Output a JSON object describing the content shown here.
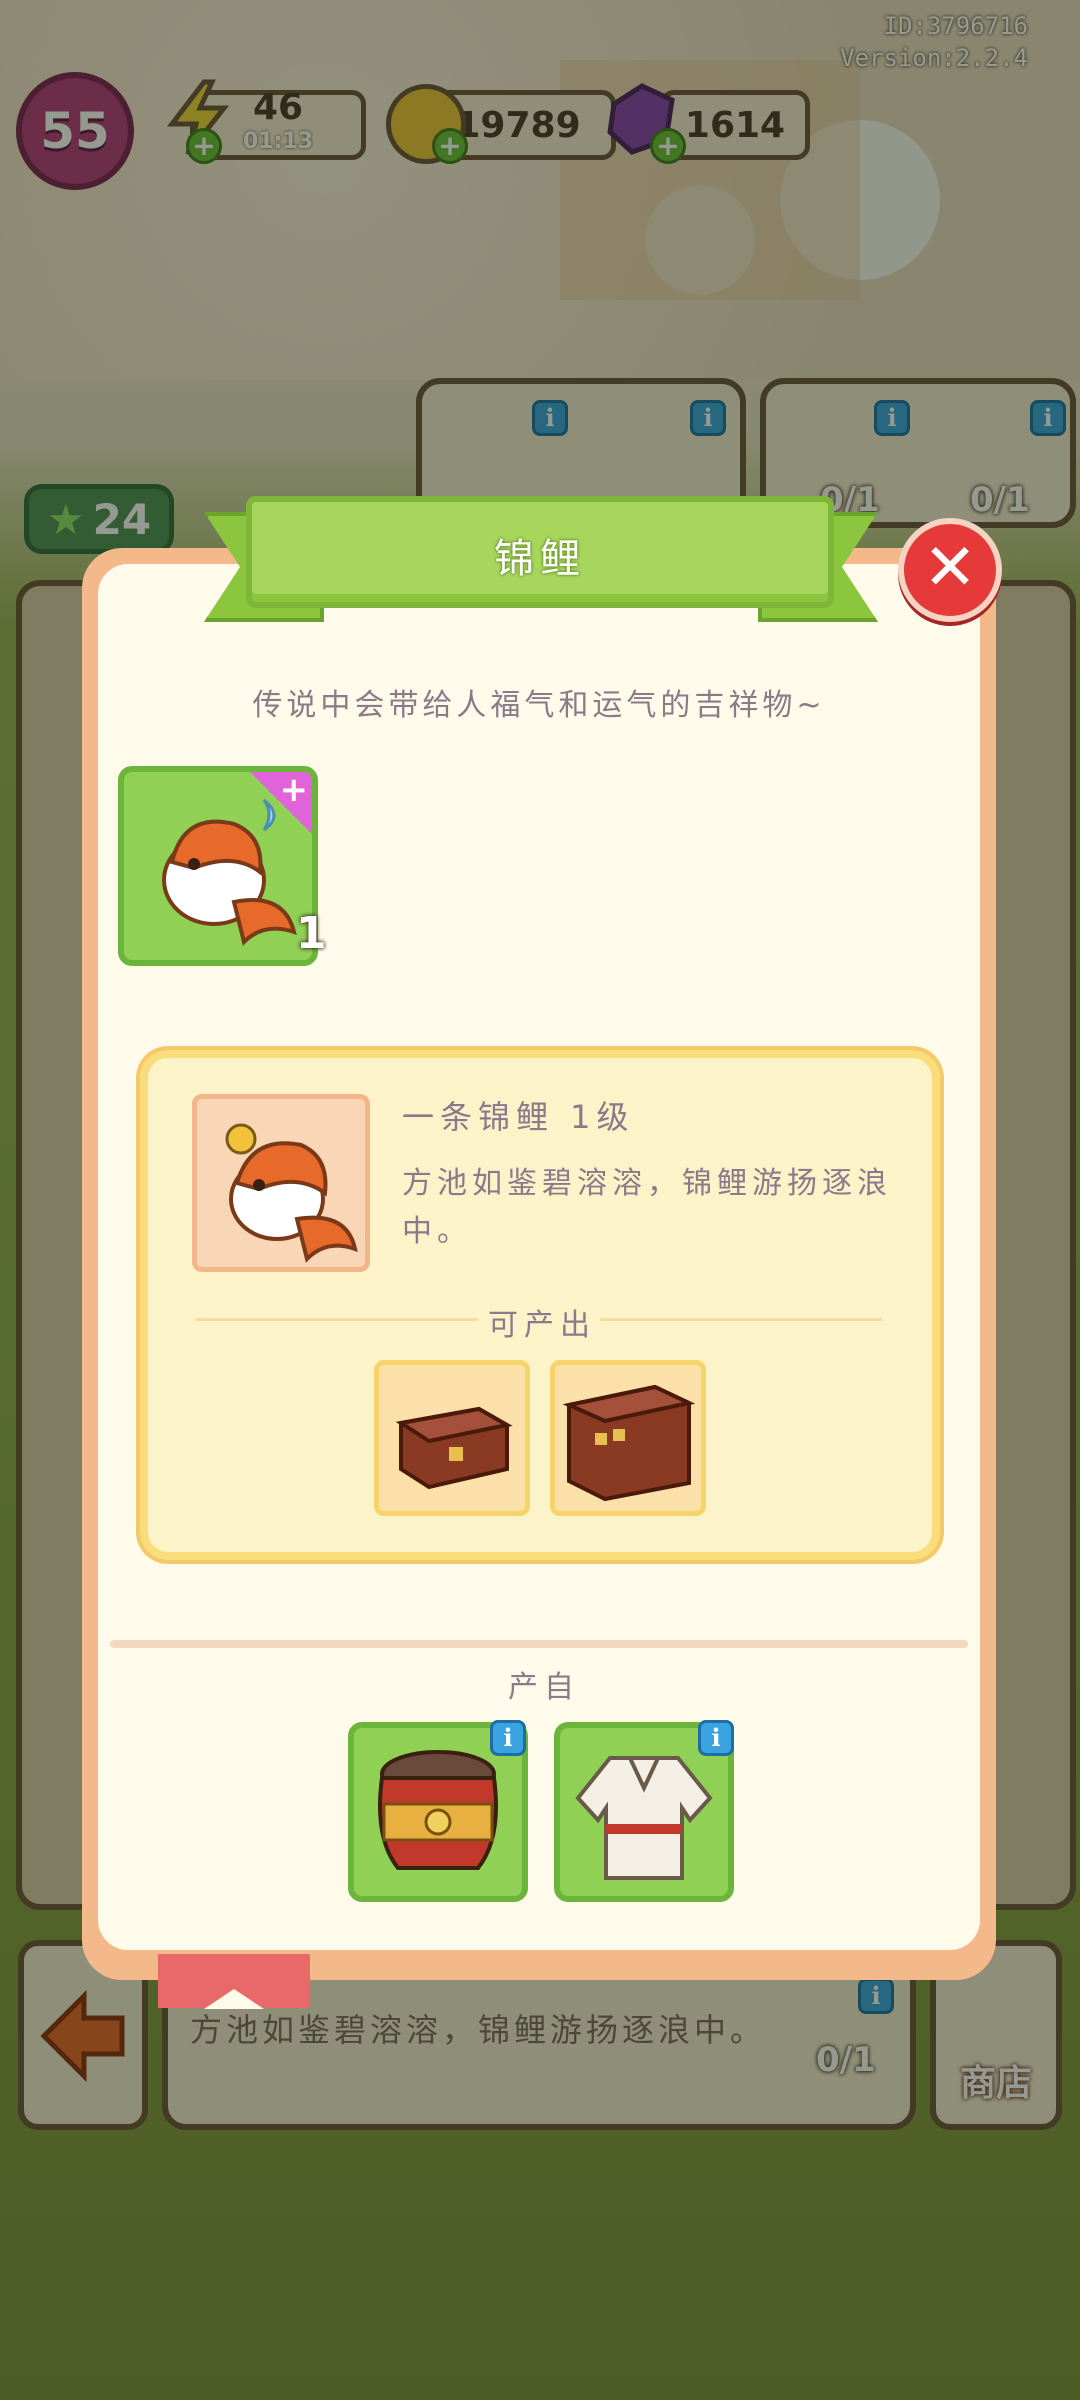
{
  "hud": {
    "id_text": "ID:3796716",
    "version_text": "Version:2.2.4",
    "level": "55",
    "energy": "46",
    "energy_timer": "01:13",
    "coins": "19789",
    "gems": "1614",
    "stars": "24"
  },
  "background": {
    "counts": [
      "0/1",
      "0/1",
      "0/1"
    ],
    "footer_desc": "方池如鉴碧溶溶，锦鲤游扬逐浪中。",
    "shop_label": "商店"
  },
  "dialog": {
    "title": "锦鲤",
    "description": "传说中会带给人福气和运气的吉祥物~",
    "owned_count": "1",
    "detail": {
      "name": "一条锦鲤  1级",
      "desc": "方池如鉴碧溶溶，锦鲤游扬逐浪中。",
      "produces_label": "可产出"
    },
    "source_label": "产自"
  },
  "colors": {
    "panel_bg": "#fffbea",
    "ribbon_green": "#a6d65c",
    "close_red": "#e63a3a",
    "tile_green": "#8fd055",
    "card_yellow": "#fdf3c8"
  }
}
